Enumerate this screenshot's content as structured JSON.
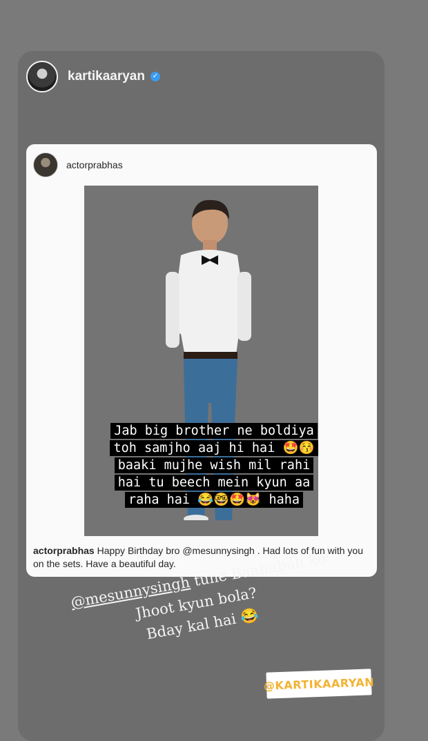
{
  "story": {
    "username": "kartikaaryan",
    "verified_icon": "verified-badge-icon"
  },
  "post": {
    "username": "actorprabhas",
    "overlay_lines": [
      "Jab big brother ne boldiya",
      "toh samjho aaj hi hai 🤩😚",
      "baaki mujhe wish mil rahi",
      "hai tu beech mein kyun aa",
      "raha hai 😂🤓🤩😻  haha"
    ],
    "caption_username": "actorprabhas",
    "caption_text": " Happy Birthday bro @mesunnysingh . Had lots of fun with you on the sets. Have a beautiful day."
  },
  "handwriting": {
    "mention": "@mesunnysingh",
    "line1_rest": " tune Baahubali ko",
    "line2": "Jhoot kyun bola?",
    "line3": "Bday kal hai 😂"
  },
  "tag_sticker": {
    "label": "@KARTIKAARYAN"
  },
  "colors": {
    "background": "#7a7a7a",
    "verified": "#3b9bf0",
    "sticker_text": "#f2b233"
  }
}
